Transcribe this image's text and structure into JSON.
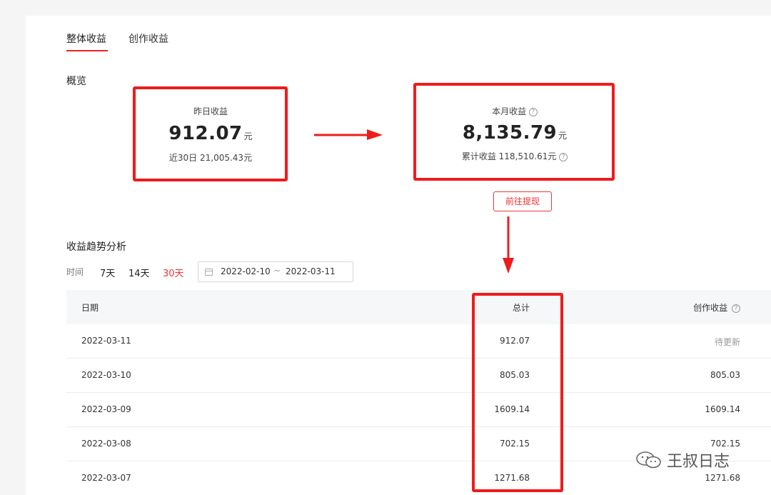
{
  "tabs": [
    {
      "label": "整体收益",
      "active": true
    },
    {
      "label": "创作收益",
      "active": false
    }
  ],
  "overview": {
    "title": "概览",
    "yesterday": {
      "label": "昨日收益",
      "amount": "912.07",
      "unit": "元",
      "sub": "近30日 21,005.43元"
    },
    "month": {
      "label": "本月收益",
      "amount": "8,135.79",
      "unit": "元",
      "sub": "累计收益 118,510.61元"
    },
    "help_glyph": "?",
    "withdraw_label": "前往提现"
  },
  "trend": {
    "title": "收益趋势分析",
    "time_label": "时间",
    "ranges": [
      "7天",
      "14天",
      "30天"
    ],
    "active_range": "30天",
    "date_start": "2022-02-10",
    "date_sep": "~",
    "date_end": "2022-03-11"
  },
  "table": {
    "headers": {
      "date": "日期",
      "total": "总计",
      "create": "创作收益"
    },
    "rows": [
      {
        "date": "2022-03-11",
        "total": "912.07",
        "create": "待更新"
      },
      {
        "date": "2022-03-10",
        "total": "805.03",
        "create": "805.03"
      },
      {
        "date": "2022-03-09",
        "total": "1609.14",
        "create": "1609.14"
      },
      {
        "date": "2022-03-08",
        "total": "702.15",
        "create": "702.15"
      },
      {
        "date": "2022-03-07",
        "total": "1271.68",
        "create": "1271.68"
      }
    ]
  },
  "watermark": {
    "text": "王叔日志",
    "icon": "wechat-icon"
  },
  "colors": {
    "accent": "#ee1c1c",
    "active_range": "#e33333"
  }
}
